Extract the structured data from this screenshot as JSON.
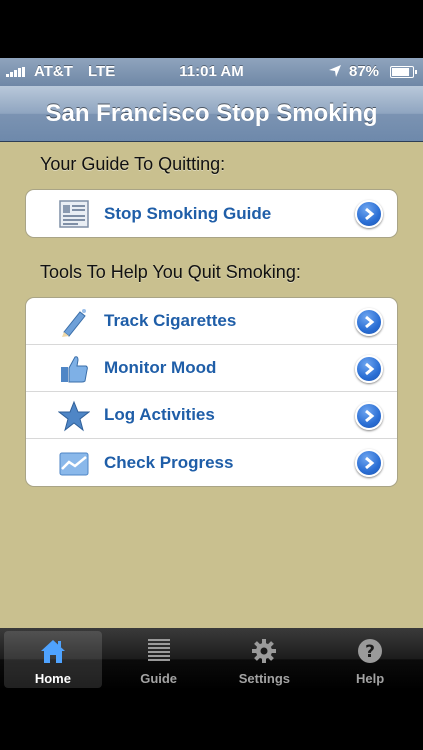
{
  "status_bar": {
    "carrier": "AT&T",
    "network": "LTE",
    "time": "11:01 AM",
    "battery_percent": "87%",
    "battery_level": 0.87
  },
  "nav": {
    "title": "San Francisco Stop Smoking"
  },
  "sections": {
    "guide_header": "Your Guide To Quitting:",
    "guide_items": [
      {
        "label": "Stop Smoking Guide",
        "icon": "document-icon"
      }
    ],
    "tools_header": "Tools To Help You Quit Smoking:",
    "tools_items": [
      {
        "label": "Track Cigarettes",
        "icon": "pencil-icon"
      },
      {
        "label": "Monitor Mood",
        "icon": "thumbs-up-icon"
      },
      {
        "label": "Log Activities",
        "icon": "star-icon"
      },
      {
        "label": "Check Progress",
        "icon": "chart-icon"
      }
    ]
  },
  "tab_bar": {
    "tabs": [
      {
        "label": "Home",
        "icon": "home-icon",
        "active": true
      },
      {
        "label": "Guide",
        "icon": "list-icon",
        "active": false
      },
      {
        "label": "Settings",
        "icon": "gear-icon",
        "active": false
      },
      {
        "label": "Help",
        "icon": "help-icon",
        "active": false
      }
    ]
  },
  "colors": {
    "background": "#c9c08f",
    "link_blue": "#1f5ea8",
    "nav_blue": "#7b93b2"
  }
}
